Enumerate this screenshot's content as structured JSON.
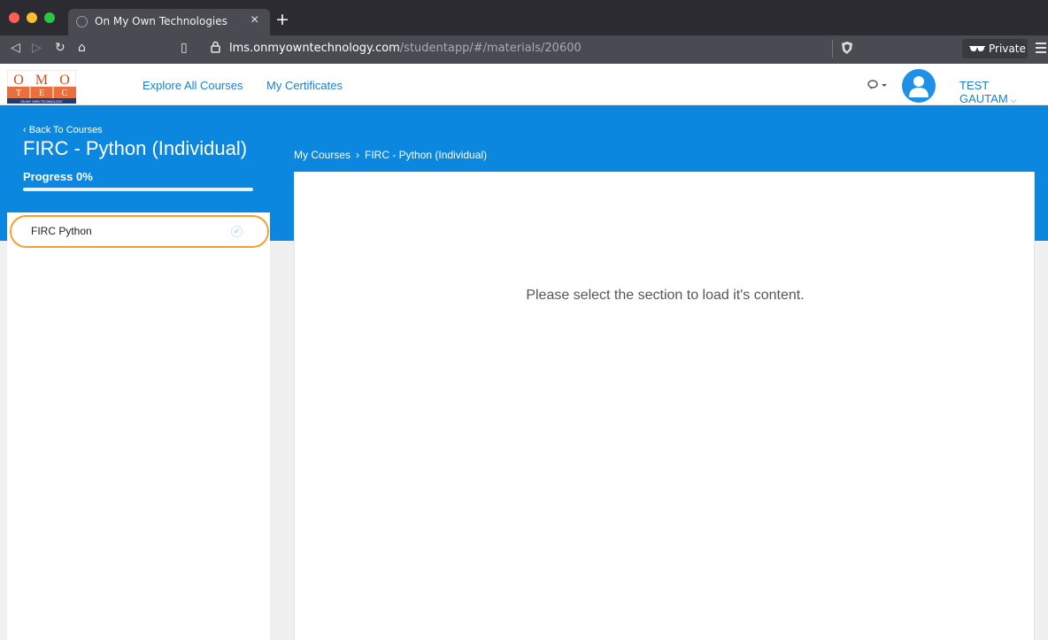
{
  "browser": {
    "tab_title": "On My Own Technologies",
    "tab_close": "×",
    "new_tab": "+",
    "url_domain": "lms.onmyowntechnology.com",
    "url_path": "/studentapp/#/materials/20600",
    "private_label": "Private",
    "traffic_lights": [
      "#ff5f57",
      "#febc2e",
      "#28c840"
    ]
  },
  "header": {
    "logo": {
      "top_letters": [
        "O",
        "M",
        "O"
      ],
      "bottom_letters": [
        "T",
        "E",
        "C"
      ],
      "tagline": "ON MY OWN TECHNOLOGY"
    },
    "nav": [
      "Explore All Courses",
      "My Certificates"
    ],
    "user_name": "TEST GAUTAM"
  },
  "course": {
    "back_label": "Back To Courses",
    "title": "FIRC - Python (Individual)",
    "progress_label": "Progress 0%",
    "progress_fraction": 0
  },
  "breadcrumb": {
    "root": "My Courses",
    "separator": "›",
    "current": "FIRC - Python (Individual)"
  },
  "sections": [
    {
      "label": "FIRC Python",
      "completed": true
    }
  ],
  "content": {
    "empty_message": "Please select the section to load it's content."
  },
  "colors": {
    "brand_blue": "#0b87df",
    "highlight_orange": "#f5a030"
  }
}
